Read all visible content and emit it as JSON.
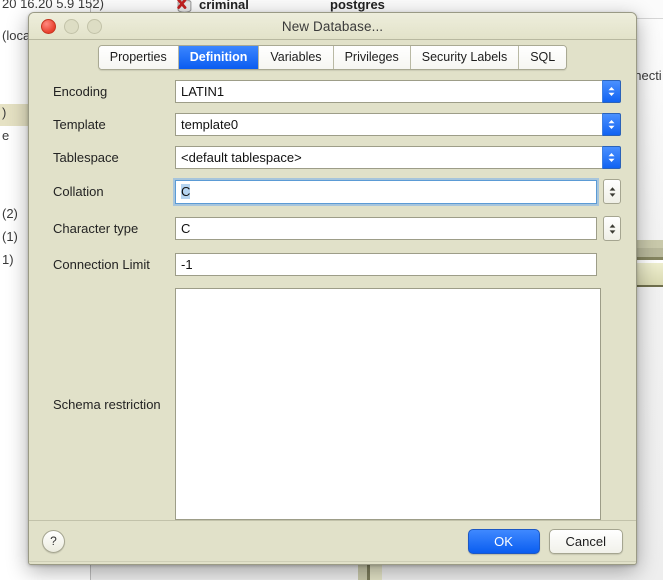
{
  "background": {
    "left_texts": [
      "20 16.20 5.9 152)",
      "(loca",
      ")",
      "e",
      "(2)",
      "(1)",
      "1)"
    ],
    "tree_item_label": "criminal",
    "tree_item_owner": "postgres",
    "tree_item_icon": "database-error-icon",
    "right_text": "nnecti"
  },
  "dialog": {
    "title": "New Database...",
    "window_controls": {
      "close": "close-button",
      "minimize": "minimize-button",
      "maximize": "maximize-button"
    },
    "tabs": [
      {
        "label": "Properties",
        "active": false
      },
      {
        "label": "Definition",
        "active": true
      },
      {
        "label": "Variables",
        "active": false
      },
      {
        "label": "Privileges",
        "active": false
      },
      {
        "label": "Security Labels",
        "active": false
      },
      {
        "label": "SQL",
        "active": false
      }
    ],
    "fields": {
      "encoding": {
        "label": "Encoding",
        "value": "LATIN1",
        "type": "combo"
      },
      "template": {
        "label": "Template",
        "value": "template0",
        "type": "combo"
      },
      "tablespace": {
        "label": "Tablespace",
        "value": "<default tablespace>",
        "type": "combo"
      },
      "collation": {
        "label": "Collation",
        "value": "C",
        "type": "text-stepper",
        "focused": true,
        "selected": true
      },
      "character_type": {
        "label": "Character type",
        "value": "C",
        "type": "text-stepper",
        "focused": false
      },
      "connection_limit": {
        "label": "Connection Limit",
        "value": "-1",
        "type": "text"
      },
      "schema_restriction": {
        "label": "Schema restriction",
        "value": "",
        "type": "textarea"
      }
    },
    "footer": {
      "help_label": "?",
      "ok_label": "OK",
      "cancel_label": "Cancel"
    }
  },
  "colors": {
    "dialog_bg": "#e1e1c9",
    "accent_blue": "#0a5cf0",
    "field_bg": "#ffffff",
    "border": "#9d9d88",
    "focus_ring": "#5b9bd5"
  }
}
